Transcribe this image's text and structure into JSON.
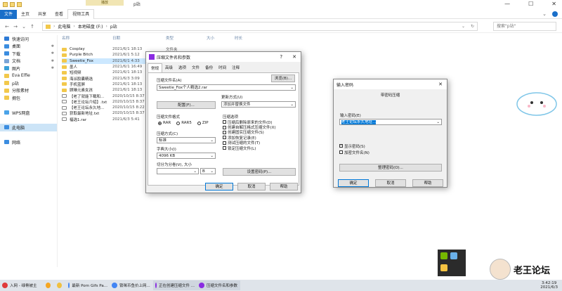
{
  "window": {
    "title": "p站",
    "context_tab": "播放"
  },
  "ribbon": {
    "tabs": [
      "文件",
      "主页",
      "共享",
      "查看",
      "视频工具"
    ]
  },
  "address": {
    "path": [
      "此电脑",
      "本地磁盘 (F:)",
      "p站"
    ],
    "search_placeholder": "搜索\"p站\""
  },
  "sidebar": {
    "items": [
      {
        "label": "快速访问",
        "icon": "star-icon",
        "color": "#2e7bd6",
        "pinned": false
      },
      {
        "label": "桌面",
        "icon": "desktop-icon",
        "color": "#3b8de0",
        "pinned": true
      },
      {
        "label": "下载",
        "icon": "download-icon",
        "color": "#3b8de0",
        "pinned": true
      },
      {
        "label": "文档",
        "icon": "document-icon",
        "color": "#7aa5d6",
        "pinned": true
      },
      {
        "label": "图片",
        "icon": "pictures-icon",
        "color": "#3aa0d8",
        "pinned": true
      },
      {
        "label": "Eva Elfie",
        "icon": "folder-icon",
        "color": "#f2c84b",
        "pinned": false
      },
      {
        "label": "p站",
        "icon": "folder-icon",
        "color": "#f2c84b",
        "pinned": false
      },
      {
        "label": "分般素材",
        "icon": "folder-icon",
        "color": "#f2c84b",
        "pinned": false
      },
      {
        "label": "拥包",
        "icon": "folder-icon",
        "color": "#f2c84b",
        "pinned": false
      },
      {
        "label": "",
        "icon": "",
        "color": "",
        "pinned": false
      },
      {
        "label": "WPS网盘",
        "icon": "cloud-icon",
        "color": "#4aa3e8",
        "pinned": false
      },
      {
        "label": "",
        "icon": "",
        "color": "",
        "pinned": false
      },
      {
        "label": "此电脑",
        "icon": "pc-icon",
        "color": "#3b8de0",
        "pinned": false,
        "selected": true
      },
      {
        "label": "",
        "icon": "",
        "color": "",
        "pinned": false
      },
      {
        "label": "网络",
        "icon": "network-icon",
        "color": "#3b8de0",
        "pinned": false
      }
    ]
  },
  "columns": {
    "name": "名称",
    "date": "日期",
    "type": "类型",
    "size": "大小",
    "length": "时长"
  },
  "files": [
    {
      "name": "Cosplay",
      "date": "2021/6/1 18:13",
      "type": "文件夹",
      "kind": "folder"
    },
    {
      "name": "Purple Bitch",
      "date": "2021/6/1 5:12",
      "type": "文件夹",
      "kind": "folder"
    },
    {
      "name": "Sweetie_Fox",
      "date": "2021/6/1 4:33",
      "type": "文件夹",
      "kind": "folder",
      "selected": true
    },
    {
      "name": "墨人",
      "date": "2021/6/1 16:49",
      "type": "",
      "kind": "folder"
    },
    {
      "name": "短视频",
      "date": "2021/6/1 18:13",
      "type": "",
      "kind": "folder"
    },
    {
      "name": "海派胶囊精选",
      "date": "2021/6/3 3:09",
      "type": "",
      "kind": "folder"
    },
    {
      "name": "手机蓝屏",
      "date": "2021/6/1 18:13",
      "type": "",
      "kind": "folder"
    },
    {
      "name": "顾琳元素女孩",
      "date": "2021/6/1 18:13",
      "type": "",
      "kind": "folder"
    },
    {
      "name": "【老了就能下载和...",
      "date": "2020/10/15 8:37",
      "type": "",
      "kind": "doc"
    },
    {
      "name": "【老王论坛介绍】.txt",
      "date": "2020/10/15 8:37",
      "type": "",
      "kind": "doc"
    },
    {
      "name": "【老王论坛永久地...",
      "date": "2020/10/15 8:22",
      "type": "",
      "kind": "doc"
    },
    {
      "name": "获取最新地址.txt",
      "date": "2020/10/15 8:37",
      "type": "",
      "kind": "doc"
    },
    {
      "name": "福选1.rar",
      "date": "2021/6/3 5:41",
      "type": "",
      "kind": "doc"
    }
  ],
  "archive_dialog": {
    "title": "压缩文件名和参数",
    "help": "?",
    "close": "✕",
    "tabs": [
      "常规",
      "高级",
      "选项",
      "文件",
      "备份",
      "时间",
      "注释"
    ],
    "archive_name_label": "压缩文件名(A)",
    "browse": "浏览(B)...",
    "archive_name": "Sweetie_Fox个人精选2.rar",
    "update_mode_label": "更新方式(U)",
    "update_mode": "添加并替换文件",
    "profiles": "配置(F)...",
    "format_label": "压缩文件格式",
    "formats": [
      "RAR",
      "RAR5",
      "ZIP"
    ],
    "method_label": "压缩方式(C)",
    "method": "标准",
    "dict_label": "字典大小(I)",
    "dict": "4096 KB",
    "split_label": "切分为分卷(V), 大小",
    "split_unit": "B",
    "options_label": "压缩选项",
    "options": [
      "压缩后删除原来的文件(D)",
      "创建自解压格式压缩文件(X)",
      "创建固实压缩文件(S)",
      "添加恢复记录(E)",
      "测试压缩的文件(T)",
      "锁定压缩文件(L)"
    ],
    "set_password": "设置密码(P)...",
    "ok": "确定",
    "cancel": "取消",
    "helpbtn": "帮助"
  },
  "password_dialog": {
    "title": "输入密码",
    "subtitle": "带密码压缩",
    "input_label": "输入密码(E)",
    "password": "老王论坛永久地址...",
    "show_password": "显示密码(S)",
    "encrypt_names": "加密文件名(N)",
    "organize": "整理密码(O)...",
    "ok": "确定",
    "cancel": "取消",
    "help": "帮助"
  },
  "taskbar": {
    "items": [
      {
        "label": "入网 - 绿骨被主",
        "color": "#e03a3a"
      },
      {
        "label": "",
        "color": "#f5a623"
      },
      {
        "label": "",
        "color": "#f0c040"
      },
      {
        "label": "最新 Porn Gifs Pa...",
        "color": "#4285f4"
      },
      {
        "label": "锁咪币鱼价上网...",
        "color": "#4285f4"
      },
      {
        "label": "正在创建压缩文件 ...",
        "color": "#8a2be2"
      },
      {
        "label": "压缩文件名和参数",
        "color": "#8a2be2"
      }
    ],
    "clock_time": "3:42:19",
    "clock_date": "2021/6/3"
  },
  "watermark": {
    "brand": "老王论坛"
  }
}
